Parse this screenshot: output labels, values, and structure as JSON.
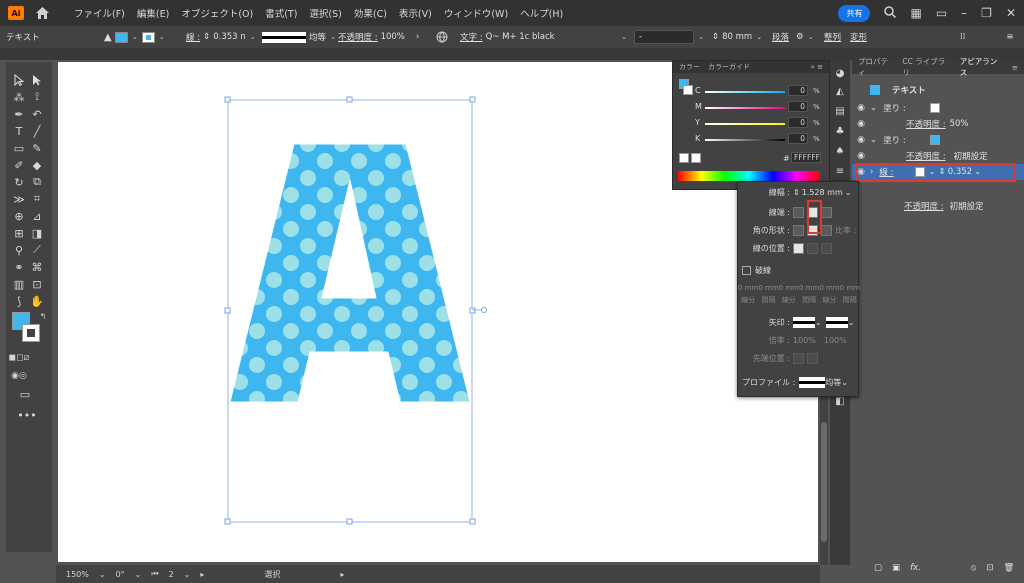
{
  "menubar": {
    "app_logo": "Ai",
    "items": [
      "ファイル(F)",
      "編集(E)",
      "オブジェクト(O)",
      "書式(T)",
      "選択(S)",
      "効果(C)",
      "表示(V)",
      "ウィンドウ(W)",
      "ヘルプ(H)"
    ],
    "share": "共有"
  },
  "controlbar": {
    "object_type": "テキスト",
    "stroke_label": "線 :",
    "stroke_weight": "0.353 n",
    "stroke_style": "均等",
    "opacity_label": "不透明度 :",
    "opacity_value": "100%",
    "char_label": "文字 :",
    "font_name": "Q~ M+ 1c black",
    "font_style": "-",
    "font_size": "80 mm",
    "paragraph_label": "段落",
    "align_label": "整列",
    "transform_label": "変形"
  },
  "statusbar": {
    "zoom": "150%",
    "rotation": "0°",
    "artboard": "2",
    "tool": "選択"
  },
  "color_panel": {
    "tab1": "カラー",
    "tab2": "カラーガイド",
    "rows": [
      {
        "label": "C",
        "value": "0"
      },
      {
        "label": "M",
        "value": "0"
      },
      {
        "label": "Y",
        "value": "0"
      },
      {
        "label": "K",
        "value": "0"
      }
    ],
    "pct": "%",
    "hex": "FFFFFF",
    "hex_prefix": "#"
  },
  "appearance_panel": {
    "tabs": [
      "プロパティ",
      "CC ライブラリ",
      "アピアランス"
    ],
    "object": "テキスト",
    "fill1": "塗り :",
    "opacity1_label": "不透明度 :",
    "opacity1_value": "50%",
    "fill2": "塗り :",
    "opacity2_label": "不透明度 :",
    "opacity2_value": "初期設定",
    "stroke_label": "線 :",
    "stroke_value": "0.352",
    "opacity3_label": "不透明度 :",
    "opacity3_value": "初期設定"
  },
  "stroke_panel": {
    "weight_label": "線幅 :",
    "weight_value": "1.528 mm",
    "cap_label": "線端 :",
    "corner_label": "角の形状 :",
    "limit_label": "比率 :",
    "align_label": "線の位置 :",
    "dash_label": "破線",
    "dash_fields": [
      "0 mm",
      "0 mm",
      "0 mm",
      "0 mm",
      "0 mm",
      "0 mm"
    ],
    "dash_sub": [
      "線分",
      "間隔",
      "線分",
      "間隔",
      "線分",
      "間隔"
    ],
    "arrow_label": "矢印 :",
    "scale_label": "倍率 :",
    "scale1": "100%",
    "scale2": "100%",
    "position_label": "先端位置 :",
    "profile_label": "プロファイル :",
    "profile_value": "均等"
  },
  "colors": {
    "letter_fill": "#3eb7f0",
    "dots": "#9ee0e8",
    "highlight": "#e03a2e",
    "accent": "#1473e6"
  },
  "artwork_text": "A"
}
